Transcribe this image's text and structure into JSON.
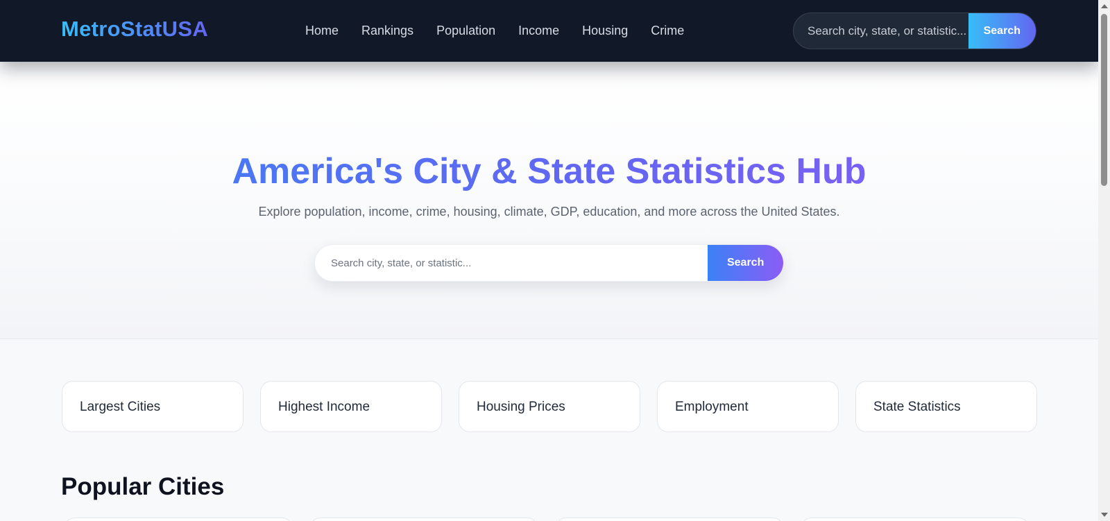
{
  "brand": {
    "name": "MetroStatUSA"
  },
  "nav": {
    "items": [
      {
        "label": "Home"
      },
      {
        "label": "Rankings"
      },
      {
        "label": "Population"
      },
      {
        "label": "Income"
      },
      {
        "label": "Housing"
      },
      {
        "label": "Crime"
      }
    ]
  },
  "header_search": {
    "placeholder": "Search city, state, or statistic...",
    "button_label": "Search"
  },
  "hero": {
    "title": "America's City & State Statistics Hub",
    "subtitle": "Explore population, income, crime, housing, climate, GDP, education, and more across the United States.",
    "search_placeholder": "Search city, state, or statistic...",
    "search_button": "Search"
  },
  "quick_links": [
    {
      "label": "Largest Cities"
    },
    {
      "label": "Highest Income"
    },
    {
      "label": "Housing Prices"
    },
    {
      "label": "Employment"
    },
    {
      "label": "State Statistics"
    }
  ],
  "popular": {
    "title": "Popular Cities"
  },
  "colors": {
    "header_bg": "#111827",
    "brand_gradient": [
      "#38bdf8",
      "#6366f1"
    ],
    "hero_gradient": [
      "#3b82f6",
      "#8b5cf6"
    ]
  }
}
